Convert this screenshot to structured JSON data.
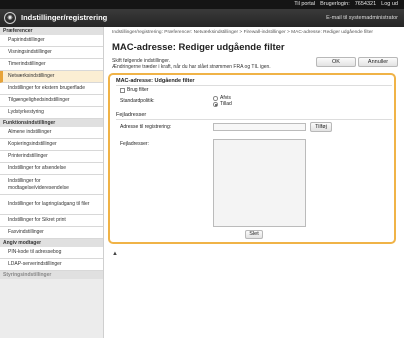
{
  "topbar": {
    "portal": "Til portal",
    "login_label": "Brugerlogin:",
    "login_value": "7654321",
    "logout": "Log ud"
  },
  "header": {
    "logo_icon": "brand-logo-icon",
    "title": "Indstillinger/registrering",
    "mail": "E-mail til systemadministrator"
  },
  "sidebar": {
    "section_preferences": "Præferencer",
    "preferences_items": [
      "Papirindstillinger",
      "Visningsindstillinger",
      "Timerindstillinger",
      "Netværksindstillinger",
      "Indstillinger for ekstern brugerflade",
      "Tilgængelighedsindstillinger",
      "Lydstyrkestyring"
    ],
    "section_functions": "Funktionsindstillinger",
    "function_items": [
      "Almene indstillinger",
      "Kopieringsindstillinger",
      "Printerindstillinger",
      "Indstillinger for afsendelse",
      "Indstillinger for modtagelse/videresendelse",
      "Indstillinger for lagring/adgang til filer",
      "Indstillinger for Sikret print",
      "Faxvindstillinger"
    ],
    "section_destination": "Angiv modtager",
    "destination_items": [
      "PIN-kode til adressebog",
      "LDAP-serverindstillinger"
    ],
    "section_dim": "Styringsindstillinger"
  },
  "main": {
    "breadcrumb": "Indstillinger/registrering: Præferencer: Netværksindstillinger > Firewall-indstillinger > MAC-adresse: Rediger udgående filter",
    "title": "MAC-adresse: Rediger udgående filter",
    "intro_line1": "Skift følgende indstillinger.",
    "intro_line2": "Ændringerne træder i kraft, når du har slået strømmen FRA og TIL igen.",
    "ok_label": "OK",
    "cancel_label": "Annuller",
    "panel_title": "MAC-adresse: Udgående filter",
    "use_filter_label": "Brug filter",
    "policy_label": "Standardpolitik:",
    "policy_options": [
      "Afvis",
      "Tillad"
    ],
    "policy_selected": "Tillad",
    "exceptions_title": "Fejladresser",
    "address_label": "Adresse til registrering:",
    "add_label": "Tilføj",
    "exceptions_list_label": "Fejladresser:",
    "delete_label": "Slet",
    "scroll_top_icon": "arrow-up-icon"
  }
}
